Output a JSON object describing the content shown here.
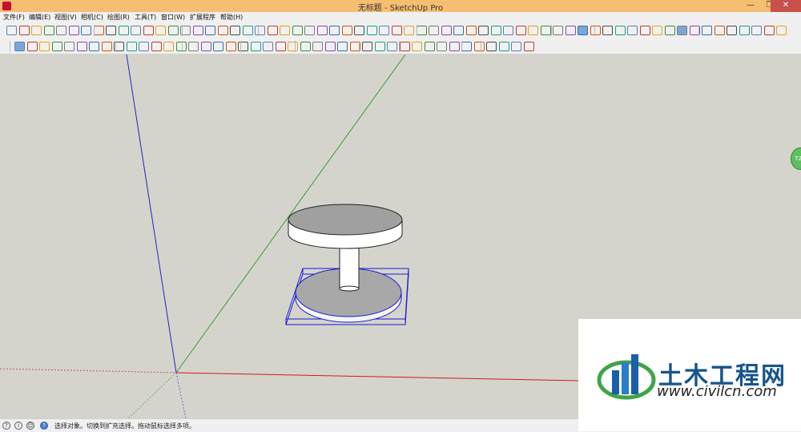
{
  "window": {
    "title": "无标题 - SketchUp Pro",
    "minimize_glyph": "—",
    "restore_glyph": "❐",
    "close_glyph": "✕"
  },
  "menu": {
    "items": [
      "文件(F)",
      "编辑(E)",
      "视图(V)",
      "相机(C)",
      "绘图(R)",
      "工具(T)",
      "窗口(W)",
      "扩展程序",
      "帮助(H)"
    ]
  },
  "toolbar": {
    "accent_color": "#7aa6d8",
    "icons": [
      "getting-started",
      "large-tool-set",
      "camera",
      "construction",
      "drawing",
      "edit",
      "principal",
      "sandbox",
      "section",
      "shadows",
      "solid-tools",
      "standard",
      "styles",
      "views",
      "warehouse",
      "measurements"
    ]
  },
  "statusbar": {
    "help_glyph": "?",
    "info_glyph": "i",
    "user_glyph": "☺",
    "text": "选择对象。切换到扩充选择。拖动鼠标选择多项。"
  },
  "tray": {
    "label": "72"
  },
  "watermark": {
    "name": "土木工程网",
    "url": "www.civilcn.com"
  },
  "colors": {
    "title_bar": "#f6be71",
    "viewport": "#d4d4cc",
    "axis_blue": "#2323c8",
    "axis_green": "#3a9b3a",
    "axis_red": "#c81e1e",
    "selection": "#1a1ad6",
    "close_button": "#c7504b"
  }
}
